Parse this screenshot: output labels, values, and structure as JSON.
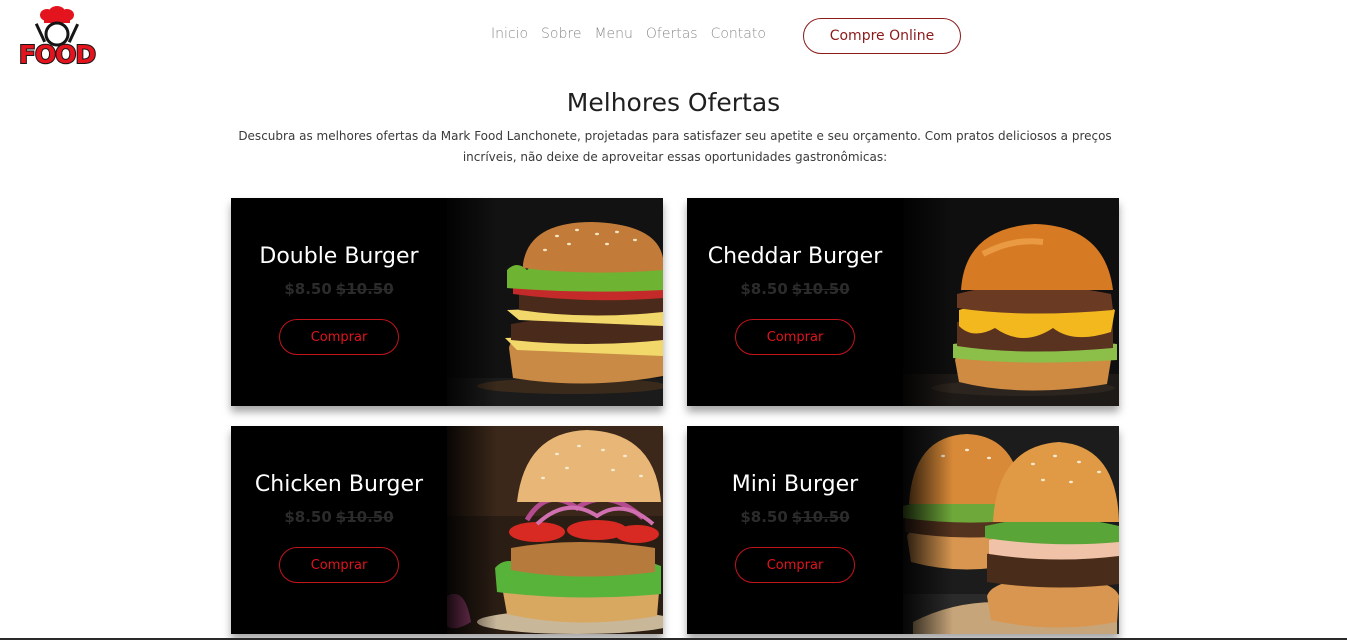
{
  "header": {
    "logo_text": "FOOD",
    "nav": [
      "Inicio",
      "Sobre",
      "Menu",
      "Ofertas",
      "Contato"
    ],
    "cta_label": "Compre Online"
  },
  "section": {
    "title": "Melhores Ofertas",
    "description": "Descubra as melhores ofertas da Mark Food Lanchonete, projetadas para satisfazer seu apetite e seu orçamento. Com pratos deliciosos a preços incríveis, não deixe de aproveitar essas oportunidades gastronômicas:"
  },
  "offers": [
    {
      "name": "Double Burger",
      "price": "$8.50",
      "old_price": "$10.50",
      "button": "Comprar"
    },
    {
      "name": "Cheddar Burger",
      "price": "$8.50",
      "old_price": "$10.50",
      "button": "Comprar"
    },
    {
      "name": "Chicken Burger",
      "price": "$8.50",
      "old_price": "$10.50",
      "button": "Comprar"
    },
    {
      "name": "Mini Burger",
      "price": "$8.50",
      "old_price": "$10.50",
      "button": "Comprar"
    }
  ],
  "colors": {
    "brand_red": "#e3141d",
    "cta_dark_red": "#8b1a1a",
    "nav_gray": "#8c8c8c",
    "card_bg": "#000000"
  }
}
